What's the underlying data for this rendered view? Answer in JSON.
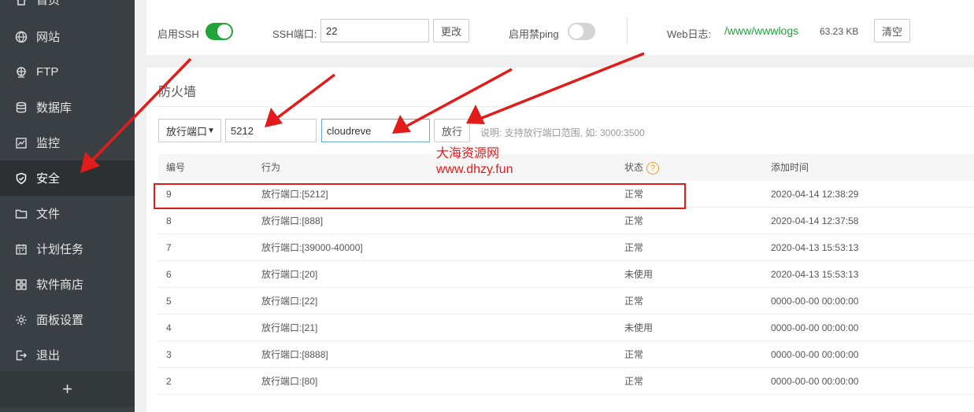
{
  "sidebar": {
    "items": [
      {
        "label": "首页",
        "icon": "home-icon"
      },
      {
        "label": "网站",
        "icon": "globe-icon"
      },
      {
        "label": "FTP",
        "icon": "ftp-icon"
      },
      {
        "label": "数据库",
        "icon": "database-icon"
      },
      {
        "label": "监控",
        "icon": "monitor-chart-icon"
      },
      {
        "label": "安全",
        "icon": "shield-icon",
        "active": true
      },
      {
        "label": "文件",
        "icon": "folder-icon"
      },
      {
        "label": "计划任务",
        "icon": "calendar-icon"
      },
      {
        "label": "软件商店",
        "icon": "grid-icon"
      },
      {
        "label": "面板设置",
        "icon": "gear-icon"
      },
      {
        "label": "退出",
        "icon": "logout-icon"
      }
    ],
    "add_label": "+"
  },
  "top": {
    "ssh_label": "启用SSH",
    "ssh_enabled": true,
    "ssh_port_label": "SSH端口:",
    "ssh_port_value": "22",
    "change_button": "更改",
    "ping_label": "启用禁ping",
    "ping_enabled": false,
    "weblog_label": "Web日志:",
    "weblog_path": "/www/wwwlogs",
    "weblog_size": "63.23 KB",
    "clear_button": "清空"
  },
  "firewall": {
    "title": "防火墙",
    "type_select": "放行端口",
    "port_value": "5212",
    "remark_value": "cloudreve",
    "allow_button": "放行",
    "note": "说明: 支持放行端口范围, 如: 3000:3500",
    "columns": [
      "编号",
      "行为",
      "状态",
      "添加时间"
    ],
    "status_help": "?",
    "rows": [
      {
        "id": "9",
        "action": "放行端口:[5212]",
        "status": "正常",
        "time": "2020-04-14 12:38:29"
      },
      {
        "id": "8",
        "action": "放行端口:[888]",
        "status": "正常",
        "time": "2020-04-14 12:37:58"
      },
      {
        "id": "7",
        "action": "放行端口:[39000-40000]",
        "status": "正常",
        "time": "2020-04-13 15:53:13"
      },
      {
        "id": "6",
        "action": "放行端口:[20]",
        "status": "未使用",
        "time": "2020-04-13 15:53:13"
      },
      {
        "id": "5",
        "action": "放行端口:[22]",
        "status": "正常",
        "time": "0000-00-00 00:00:00"
      },
      {
        "id": "4",
        "action": "放行端口:[21]",
        "status": "未使用",
        "time": "0000-00-00 00:00:00"
      },
      {
        "id": "3",
        "action": "放行端口:[8888]",
        "status": "正常",
        "time": "0000-00-00 00:00:00"
      },
      {
        "id": "2",
        "action": "放行端口:[80]",
        "status": "正常",
        "time": "0000-00-00 00:00:00"
      }
    ]
  },
  "watermark": {
    "line1": "大海资源网",
    "line2": "www.dhzy.fun"
  },
  "colors": {
    "sidebar_bg": "#3a3f43",
    "active_bg": "#2c3033",
    "accent_green": "#20a53a",
    "annotation_red": "#e21b1b"
  }
}
